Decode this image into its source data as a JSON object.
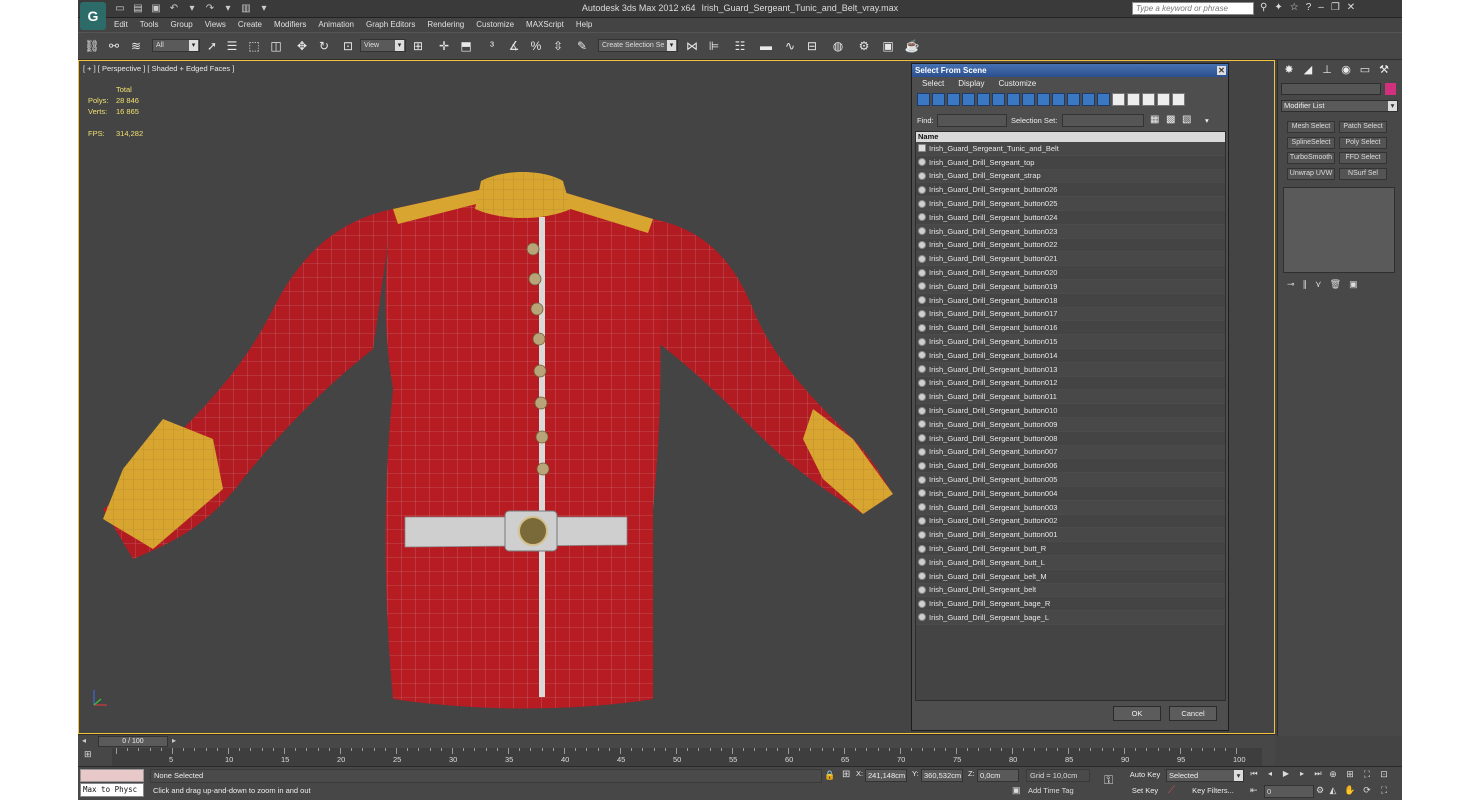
{
  "window": {
    "app_name": "Autodesk 3ds Max  2012 x64",
    "file_name": "Irish_Guard_Sergeant_Tunic_and_Belt_vray.max",
    "search_placeholder": "Type a keyword or phrase"
  },
  "menu": [
    "Edit",
    "Tools",
    "Group",
    "Views",
    "Create",
    "Modifiers",
    "Animation",
    "Graph Editors",
    "Rendering",
    "Customize",
    "MAXScript",
    "Help"
  ],
  "toolbar": {
    "filter_value": "All",
    "coord_value": "View",
    "named_selection": "Create Selection Se"
  },
  "viewport": {
    "label": "[ + ] [ Perspective ] [ Shaded + Edged Faces ]",
    "stats_header": "Total",
    "polys_label": "Polys:",
    "polys_value": "28 846",
    "verts_label": "Verts:",
    "verts_value": "16 865",
    "fps_label": "FPS:",
    "fps_value": "314,282"
  },
  "dialog": {
    "title": "Select From Scene",
    "menu": [
      "Select",
      "Display",
      "Customize"
    ],
    "find_label": "Find:",
    "selection_set_label": "Selection Set:",
    "column_header": "Name",
    "items": [
      "Irish_Guard_Sergeant_Tunic_and_Belt",
      "Irish_Guard_Drill_Sergeant_top",
      "Irish_Guard_Drill_Sergeant_strap",
      "Irish_Guard_Drill_Sergeant_button026",
      "Irish_Guard_Drill_Sergeant_button025",
      "Irish_Guard_Drill_Sergeant_button024",
      "Irish_Guard_Drill_Sergeant_button023",
      "Irish_Guard_Drill_Sergeant_button022",
      "Irish_Guard_Drill_Sergeant_button021",
      "Irish_Guard_Drill_Sergeant_button020",
      "Irish_Guard_Drill_Sergeant_button019",
      "Irish_Guard_Drill_Sergeant_button018",
      "Irish_Guard_Drill_Sergeant_button017",
      "Irish_Guard_Drill_Sergeant_button016",
      "Irish_Guard_Drill_Sergeant_button015",
      "Irish_Guard_Drill_Sergeant_button014",
      "Irish_Guard_Drill_Sergeant_button013",
      "Irish_Guard_Drill_Sergeant_button012",
      "Irish_Guard_Drill_Sergeant_button011",
      "Irish_Guard_Drill_Sergeant_button010",
      "Irish_Guard_Drill_Sergeant_button009",
      "Irish_Guard_Drill_Sergeant_button008",
      "Irish_Guard_Drill_Sergeant_button007",
      "Irish_Guard_Drill_Sergeant_button006",
      "Irish_Guard_Drill_Sergeant_button005",
      "Irish_Guard_Drill_Sergeant_button004",
      "Irish_Guard_Drill_Sergeant_button003",
      "Irish_Guard_Drill_Sergeant_button002",
      "Irish_Guard_Drill_Sergeant_button001",
      "Irish_Guard_Drill_Sergeant_butt_R",
      "Irish_Guard_Drill_Sergeant_butt_L",
      "Irish_Guard_Drill_Sergeant_belt_M",
      "Irish_Guard_Drill_Sergeant_belt",
      "Irish_Guard_Drill_Sergeant_bage_R",
      "Irish_Guard_Drill_Sergeant_bage_L"
    ],
    "ok_label": "OK",
    "cancel_label": "Cancel"
  },
  "command_panel": {
    "modifier_list": "Modifier List",
    "buttons": [
      "Mesh Select",
      "Patch Select",
      "SplineSelect",
      "Poly Select",
      "TurboSmooth",
      "FFD Select",
      "Unwrap UVW",
      "NSurf Sel"
    ],
    "swatch_color": "#d0307c"
  },
  "timeline": {
    "slider_text": "0 / 100",
    "ticks": [
      "5",
      "10",
      "15",
      "20",
      "25",
      "30",
      "35",
      "40",
      "45",
      "50",
      "55",
      "60",
      "65",
      "70",
      "75",
      "80",
      "85",
      "90",
      "95",
      "100"
    ]
  },
  "status": {
    "maxscript": "Max to Physc",
    "selection": "None Selected",
    "prompt": "Click and drag up-and-down to zoom in and out",
    "x_label": "X:",
    "x_value": "241,148cm",
    "y_label": "Y:",
    "y_value": "360,532cm",
    "z_label": "Z:",
    "z_value": "0,0cm",
    "grid": "Grid = 10,0cm",
    "add_time_tag": "Add Time Tag",
    "auto_key": "Auto Key",
    "set_key": "Set Key",
    "selected": "Selected",
    "key_filters": "Key Filters...",
    "frame": "0"
  }
}
